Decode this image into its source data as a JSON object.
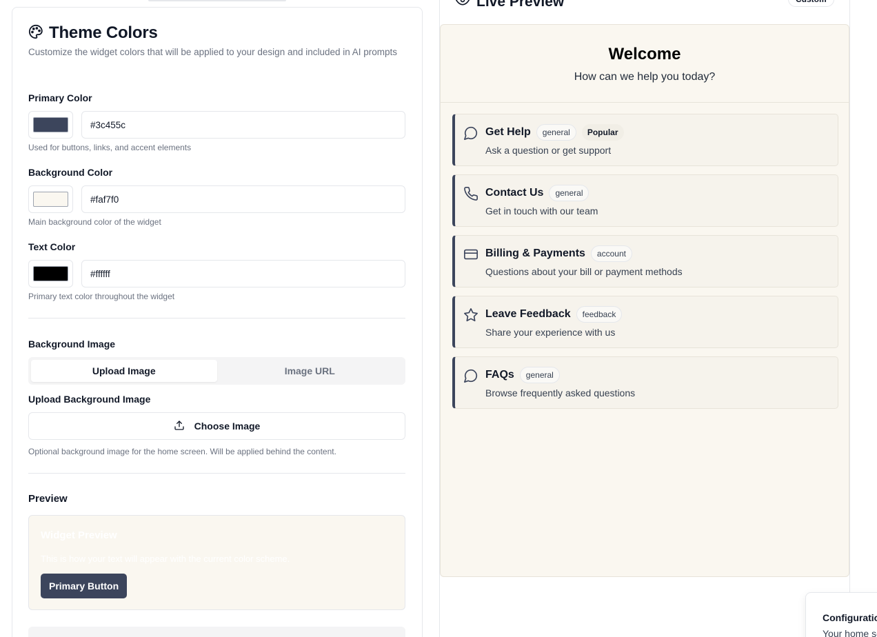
{
  "theme_colors": {
    "title": "Theme Colors",
    "description": "Customize the widget colors that will be applied to your design and included in AI prompts",
    "primary": {
      "label": "Primary Color",
      "value": "#3c455c",
      "swatch": "#3c455c",
      "hint": "Used for buttons, links, and accent elements"
    },
    "background": {
      "label": "Background Color",
      "value": "#faf7f0",
      "swatch": "#faf7f0",
      "hint": "Main background color of the widget"
    },
    "text": {
      "label": "Text Color",
      "value": "#ffffff",
      "swatch": "#000000",
      "hint": "Primary text color throughout the widget"
    }
  },
  "background_image": {
    "label": "Background Image",
    "tabs": [
      "Upload Image",
      "Image URL"
    ],
    "active_tab": "Upload Image",
    "upload_label": "Upload Background Image",
    "choose_button": "Choose Image",
    "hint": "Optional background image for the home screen. Will be applied behind the content."
  },
  "preview": {
    "label": "Preview",
    "widget_title": "Widget Preview",
    "widget_text": "This is how your text will appear with the current color scheme.",
    "button_label": "Primary Button"
  },
  "live_preview": {
    "title": "Live Preview",
    "badge": "Custom",
    "welcome_title": "Welcome",
    "welcome_subtitle": "How can we help you today?",
    "items": [
      {
        "icon": "message-circle-icon",
        "title": "Get Help",
        "tag": "general",
        "popular": "Popular",
        "desc": "Ask a question or get support"
      },
      {
        "icon": "phone-icon",
        "title": "Contact Us",
        "tag": "general",
        "desc": "Get in touch with our team"
      },
      {
        "icon": "credit-card-icon",
        "title": "Billing & Payments",
        "tag": "account",
        "desc": "Questions about your bill or payment methods"
      },
      {
        "icon": "star-icon",
        "title": "Leave Feedback",
        "tag": "feedback",
        "desc": "Share your experience with us"
      },
      {
        "icon": "message-circle-icon",
        "title": "FAQs",
        "tag": "general",
        "desc": "Browse frequently asked questions"
      }
    ]
  },
  "config_card": {
    "title": "Configuration",
    "text": "Your home screen"
  },
  "colors": {
    "accent": "#3c455c",
    "widget_bg": "#faf7f0",
    "border": "#e5e7eb"
  }
}
